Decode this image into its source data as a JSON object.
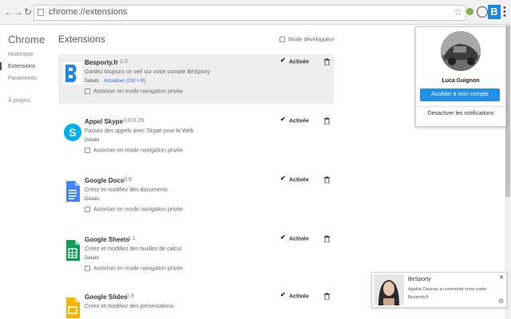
{
  "browser": {
    "url": "chrome://extensions"
  },
  "sidebar": {
    "title": "Chrome",
    "items": [
      {
        "label": "Historique"
      },
      {
        "label": "Extensions"
      },
      {
        "label": "Paramètres"
      },
      {
        "label": "À propos"
      }
    ]
  },
  "main": {
    "title": "Extensions",
    "dev_mode_label": "Mode développeur",
    "extensions": [
      {
        "name": "Besporty.fr",
        "version": "1.0",
        "description": "Gardez toujours un oeil sur votre compte BeSporty",
        "details": "Détails",
        "update": "Actualiser (Ctrl + R)",
        "incognito": "Autoriser en mode navigation privée",
        "enabled": "Activée"
      },
      {
        "name": "Appel Skype",
        "version": "0.0.0.26",
        "description": "Passez des appels avec Skype pour le Web",
        "details": "Détails",
        "incognito": "Autoriser en mode navigation privée",
        "enabled": "Activée"
      },
      {
        "name": "Google Docs",
        "version": "0.9",
        "description": "Créez et modifiez des documents",
        "details": "Détails",
        "incognito": "Autoriser en mode navigation privée",
        "enabled": "Activée"
      },
      {
        "name": "Google Sheets",
        "version": "1.1",
        "description": "Créez et modifiez des feuilles de calcul",
        "details": "Détails",
        "incognito": "Autoriser en mode navigation privée",
        "enabled": "Activée"
      },
      {
        "name": "Google Slides",
        "version": "0.9",
        "description": "Créez et modifiez des présentations",
        "enabled": "Activée"
      }
    ]
  },
  "popup": {
    "user_name": "Luca Guignon",
    "access_button": "Accéder à mon compte",
    "disable_notifications": "Désactiver les notifications"
  },
  "notification": {
    "title": "BeSporty",
    "message": "Agathe Daunay a commenté votre sortie",
    "source": "Besporty.fr"
  },
  "colors": {
    "accent": "#2190e6",
    "link": "#2962ff"
  }
}
